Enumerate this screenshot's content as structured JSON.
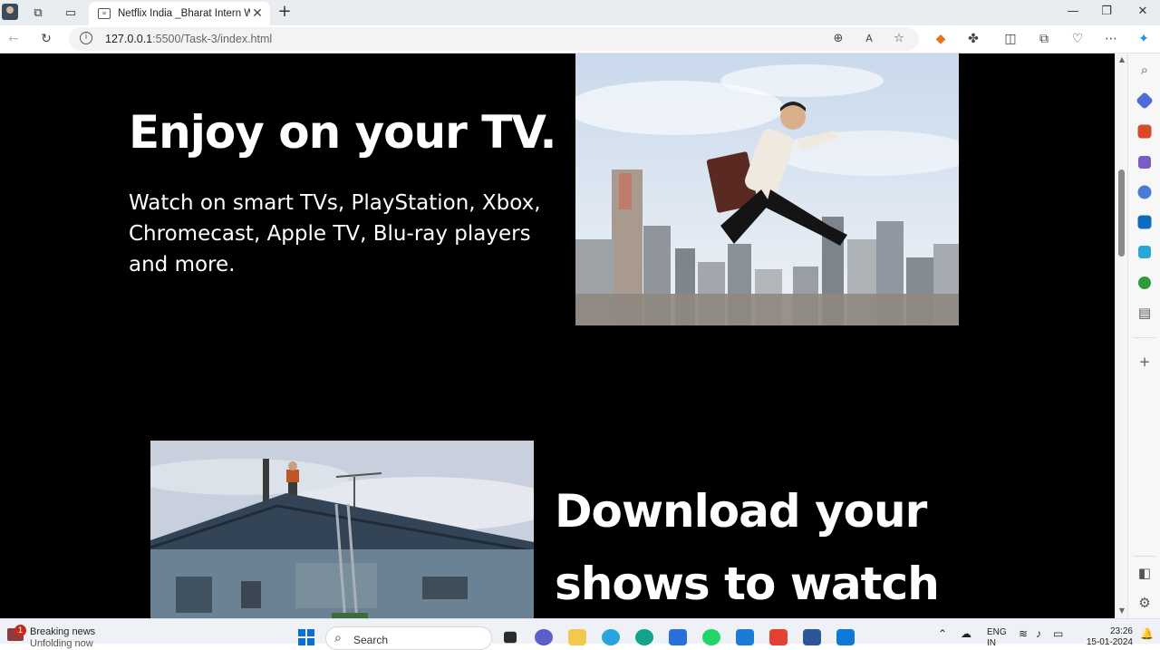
{
  "browser": {
    "tab_title": "Netflix India _Bharat Intern Watch",
    "tab_favicon": "netflix-favicon",
    "tab_close": "✕",
    "new_tab": "+",
    "window": {
      "minimize": "—",
      "maximize": "❐",
      "close": "✕"
    },
    "url_host": "127.0.0.1",
    "url_rest": ":5500/Task-3/index.html",
    "info": "i"
  },
  "page": {
    "section1": {
      "heading": "Enjoy on your TV.",
      "text": "Watch on smart TVs, PlayStation, Xbox, Chromecast, Apple TV, Blu-ray players and more."
    },
    "section2": {
      "heading": "Download your shows to watch"
    }
  },
  "taskbar": {
    "news_badge": "1",
    "news_title": "Breaking news",
    "news_sub": "Unfolding now",
    "search_label": "Search",
    "lang_1": "ENG",
    "lang_2": "IN",
    "time": "23:26",
    "date": "15-01-2024"
  },
  "colors": {
    "page_bg": "#000000",
    "text": "#ffffff",
    "accent": "#0a6fd6"
  }
}
